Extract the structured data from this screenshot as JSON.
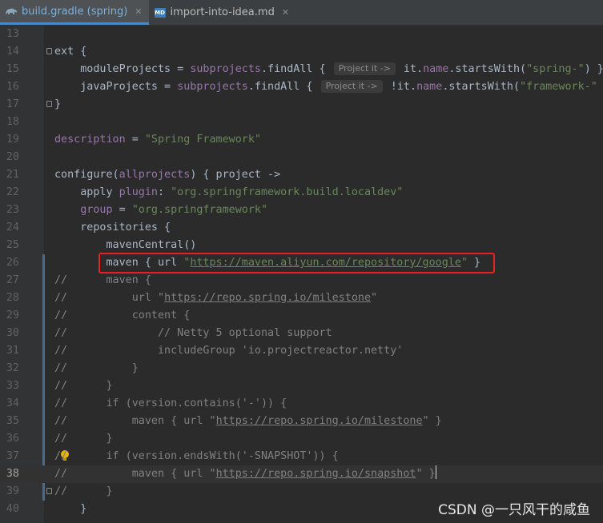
{
  "tabs": [
    {
      "label": "build.gradle (spring)",
      "icon": "gradle-elephant-icon",
      "active": true
    },
    {
      "label": "import-into-idea.md",
      "icon": "markdown-file-icon",
      "active": false
    }
  ],
  "colors": {
    "background": "#2b2b2b",
    "keyword": "#cc7832",
    "property": "#9876aa",
    "string": "#6a8759",
    "comment": "#808080",
    "highlight_box": "#e8231f"
  },
  "editor": {
    "hints": {
      "project_it": "Project it ->"
    },
    "lines": [
      {
        "n": "13"
      },
      {
        "n": "14",
        "t": [
          "ext {"
        ]
      },
      {
        "n": "15",
        "t": [
          "    moduleProjects = ",
          "subprojects",
          ".findAll { ",
          " it.",
          "name",
          ".startsWith(",
          "\"spring-\"",
          ") }"
        ]
      },
      {
        "n": "16",
        "t": [
          "    javaProjects = ",
          "subprojects",
          ".findAll { ",
          " !it.",
          "name",
          ".startsWith(",
          "\"framework-\""
        ]
      },
      {
        "n": "17",
        "t": [
          "}"
        ]
      },
      {
        "n": "18"
      },
      {
        "n": "19",
        "t": [
          "description",
          " = ",
          "\"Spring Framework\""
        ]
      },
      {
        "n": "20"
      },
      {
        "n": "21",
        "t": [
          "configure(",
          "allprojects",
          ") { project ->"
        ]
      },
      {
        "n": "22",
        "t": [
          "    apply ",
          "plugin",
          ": ",
          "\"org.springframework.build.localdev\""
        ]
      },
      {
        "n": "23",
        "t": [
          "    ",
          "group",
          " = ",
          "\"org.springframework\""
        ]
      },
      {
        "n": "24",
        "t": [
          "    repositories {"
        ]
      },
      {
        "n": "25",
        "t": [
          "        mavenCentral()"
        ]
      },
      {
        "n": "26",
        "t": [
          "        maven { url ",
          "\"",
          "https://maven.aliyun.com/repository/google",
          "\"",
          " }"
        ]
      },
      {
        "n": "27",
        "t": [
          "//",
          "      maven {"
        ]
      },
      {
        "n": "28",
        "t": [
          "//",
          "          url ",
          "\"",
          "https://repo.spring.io/milestone",
          "\""
        ]
      },
      {
        "n": "29",
        "t": [
          "//",
          "          content {"
        ]
      },
      {
        "n": "30",
        "t": [
          "//",
          "              // Netty 5 optional support"
        ]
      },
      {
        "n": "31",
        "t": [
          "//",
          "              includeGroup 'io.projectreactor.netty'"
        ]
      },
      {
        "n": "32",
        "t": [
          "//",
          "          }"
        ]
      },
      {
        "n": "33",
        "t": [
          "//",
          "      }"
        ]
      },
      {
        "n": "34",
        "t": [
          "//",
          "      if (version.contains('-')) {"
        ]
      },
      {
        "n": "35",
        "t": [
          "//",
          "          maven { url \"",
          "https://repo.spring.io/milestone",
          "\" }"
        ]
      },
      {
        "n": "36",
        "t": [
          "//",
          "      }"
        ]
      },
      {
        "n": "37",
        "t": [
          "//",
          "      if (version.endsWith('-SNAPSHOT')) {"
        ]
      },
      {
        "n": "38",
        "t": [
          "//",
          "          maven { url \"",
          "https://repo.spring.io/snapshot",
          "\" }"
        ]
      },
      {
        "n": "39",
        "t": [
          "//",
          "      }"
        ]
      },
      {
        "n": "40",
        "t": [
          "    }"
        ]
      }
    ]
  },
  "watermark": "CSDN @一只风干的咸鱼"
}
